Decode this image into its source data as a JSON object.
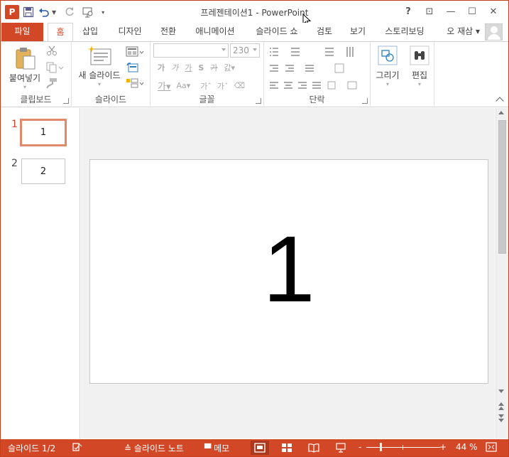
{
  "window": {
    "title": "프레젠테이션1 - PowerPoint",
    "logo_letter": "P",
    "controls": [
      "?",
      "⊡",
      "—",
      "☐",
      "✕"
    ]
  },
  "tabs": [
    {
      "label": "파일"
    },
    {
      "label": "홈"
    },
    {
      "label": "삽입"
    },
    {
      "label": "디자인"
    },
    {
      "label": "전환"
    },
    {
      "label": "애니메이션"
    },
    {
      "label": "슬라이드 쇼"
    },
    {
      "label": "검토"
    },
    {
      "label": "보기"
    },
    {
      "label": "스토리보딩"
    }
  ],
  "user": {
    "name": "오 재삼 ▾"
  },
  "ribbon": {
    "clipboard": {
      "label": "클립보드",
      "paste": "붙여넣기"
    },
    "slides": {
      "label": "슬라이드",
      "new_slide": "새 슬라이드"
    },
    "font": {
      "label": "글꼴",
      "font_size": "230",
      "font_name": ""
    },
    "paragraph": {
      "label": "단락"
    },
    "drawing": {
      "label": "그리기"
    },
    "editing": {
      "label": "편집"
    }
  },
  "thumbnails": [
    {
      "number": "1",
      "text": "1",
      "selected": true
    },
    {
      "number": "2",
      "text": "2",
      "selected": false
    }
  ],
  "slide": {
    "text": "1"
  },
  "status": {
    "slide_indicator": "슬라이드 1/2",
    "notes": "슬라이드 노트",
    "comments": "메모",
    "zoom_minus": "-",
    "zoom_plus": "+",
    "zoom": "44 %",
    "zoom_level": 0.44
  },
  "colors": {
    "accent": "#d24726",
    "slide_bg": "#ffffff",
    "editor_bg": "#f1f1f1"
  }
}
